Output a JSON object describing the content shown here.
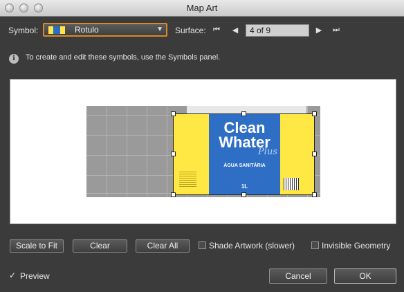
{
  "window": {
    "title": "Map Art"
  },
  "symbol": {
    "label": "Symbol:",
    "value": "Rotulo"
  },
  "surface": {
    "label": "Surface:",
    "value": "4 of 9"
  },
  "info": {
    "text": "To create and edit these symbols, use the Symbols panel."
  },
  "artwork": {
    "brand_line1": "Clean",
    "brand_line2": "Whater",
    "brand_accent": "Plus",
    "subtitle": "ÁGUA SANITÁRIA",
    "volume": "1L"
  },
  "buttons": {
    "scale_to_fit": "Scale to Fit",
    "clear": "Clear",
    "clear_all": "Clear All",
    "cancel": "Cancel",
    "ok": "OK"
  },
  "options": {
    "shade_artwork": {
      "label": "Shade Artwork (slower)",
      "checked": false
    },
    "invisible_geometry": {
      "label": "Invisible Geometry",
      "checked": false
    },
    "preview": {
      "label": "Preview",
      "checked": true
    }
  },
  "colors": {
    "focus_ring": "#d88a2a",
    "label_yellow": "#ffe843",
    "label_blue": "#2e6ec5"
  }
}
